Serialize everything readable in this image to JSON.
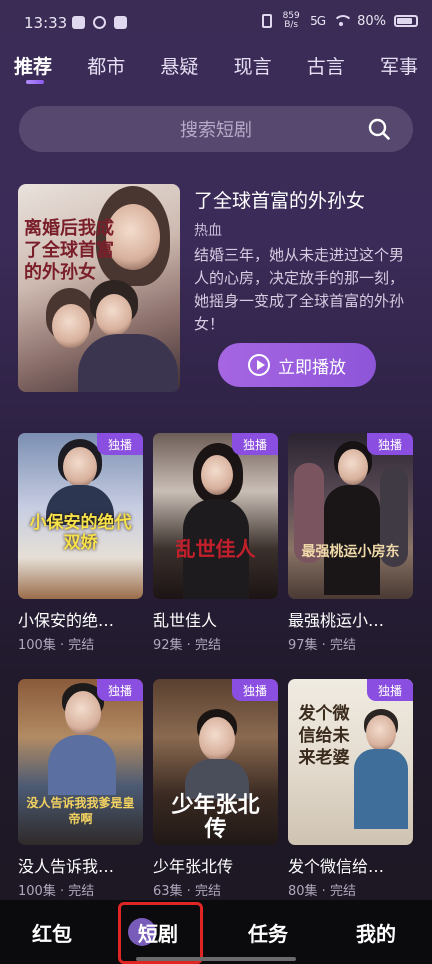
{
  "status_bar": {
    "time": "13:33",
    "net_speed": "859 B/s",
    "signal": "5G",
    "battery": "80%"
  },
  "tabs": [
    {
      "label": "推荐",
      "active": true
    },
    {
      "label": "都市",
      "active": false
    },
    {
      "label": "悬疑",
      "active": false
    },
    {
      "label": "现言",
      "active": false
    },
    {
      "label": "古言",
      "active": false
    },
    {
      "label": "军事",
      "active": false
    }
  ],
  "search": {
    "placeholder": "搜索短剧"
  },
  "featured": {
    "poster_text": "离婚后我成了全球首富的外孙女",
    "title": "了全球首富的外孙女",
    "tag": "热血",
    "description": "结婚三年，她从未走进过这个男人的心房，决定放手的那一刻，她摇身一变成了全球首富的外孙女！",
    "play_label": "立即播放"
  },
  "badge_label": "独播",
  "dramas": [
    {
      "poster_text": "小保安的绝代双娇",
      "title": "小保安的绝…",
      "meta": "100集 · 完结"
    },
    {
      "poster_text": "乱世佳人",
      "title": "乱世佳人",
      "meta": "92集 · 完结"
    },
    {
      "poster_text": "最强桃运小房东",
      "title": "最强桃运小…",
      "meta": "97集 · 完结"
    },
    {
      "poster_text": "没人告诉我我爹是皇帝啊",
      "title": "没人告诉我…",
      "meta": "100集 · 完结"
    },
    {
      "poster_text": "少年张北传",
      "title": "少年张北传",
      "meta": "63集 · 完结"
    },
    {
      "poster_text": "发个微信给未来老婆",
      "title": "发个微信给…",
      "meta": "80集 · 完结"
    }
  ],
  "bottom_nav": [
    {
      "label": "红包",
      "active": false
    },
    {
      "label": "短剧",
      "active": true
    },
    {
      "label": "任务",
      "active": false
    },
    {
      "label": "我的",
      "active": false
    }
  ],
  "colors": {
    "accent": "#8a4fe0",
    "play_button": "#9c5fe0",
    "highlight": "#e02525"
  }
}
